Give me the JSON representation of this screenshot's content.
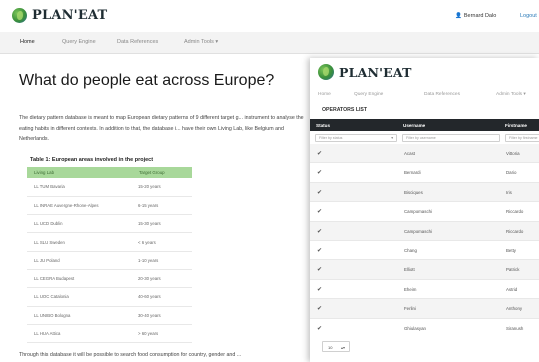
{
  "app": {
    "brand": "PLAN'EAT"
  },
  "topbar": {
    "user": "Bernard Dalo",
    "logout": "Logout"
  },
  "nav": {
    "items": [
      "Home",
      "Query Engine",
      "Data References",
      "Admin Tools ▾"
    ]
  },
  "page": {
    "title": "What do people eat across Europe?",
    "intro": "The dietary pattern database is meant to map European dietary patterns of 9 different target g... instrument to analyse the eating habits in different contexts. In addition to that, the database i... have their own Living Lab, like Belgium and Netherlands.",
    "outro": "Through this database it will be possible to search food consumption for country, gender and ..."
  },
  "living_labs_table": {
    "caption": "Table 1: European areas involved in the project",
    "columns": [
      "Living Lab",
      "Target Group"
    ],
    "rows": [
      [
        "LL TUM Bavaria",
        "15-20 years"
      ],
      [
        "LL INRAE Auvergne-Rhone-Alpes",
        "6-15 years"
      ],
      [
        "LL UCD Dublin",
        "15-30 years"
      ],
      [
        "LL SLU Sweden",
        "< 6 years"
      ],
      [
        "LL JU Poland",
        "1-10 years"
      ],
      [
        "LL CEGRA Budapest",
        "20-30 years"
      ],
      [
        "LL UOC Catalonia",
        "40-60 years"
      ],
      [
        "LL UNIBO Bologna",
        "30-40 years"
      ],
      [
        "LL HUA Attica",
        "> 60 years"
      ]
    ]
  },
  "overlay": {
    "nav": [
      "Home",
      "Query Engine",
      "Data References",
      "Admin Tools ▾"
    ],
    "title": "OPERATORS LIST",
    "columns": [
      "Status",
      "Username",
      "Firstname"
    ],
    "filters": {
      "status_placeholder": "Filter by status",
      "username_placeholder": "Filter by username",
      "firstname_placeholder": "Filter by firstname"
    },
    "rows": [
      {
        "status": "✔",
        "username": "Acast",
        "firstname": "Vittoria"
      },
      {
        "status": "✔",
        "username": "Bernardi",
        "firstname": "Dario"
      },
      {
        "status": "✔",
        "username": "Bisciques",
        "firstname": "Iris"
      },
      {
        "status": "✔",
        "username": "Campomaschi",
        "firstname": "Riccardo"
      },
      {
        "status": "✔",
        "username": "Campomaschi",
        "firstname": "Riccardo"
      },
      {
        "status": "✔",
        "username": "Chang",
        "firstname": "Betty"
      },
      {
        "status": "✔",
        "username": "Elliott",
        "firstname": "Patrick"
      },
      {
        "status": "✔",
        "username": "Eheim",
        "firstname": "Astrid"
      },
      {
        "status": "✔",
        "username": "Ferlini",
        "firstname": "Anthony"
      },
      {
        "status": "✔",
        "username": "Ghiulasyan",
        "firstname": "Siranush"
      }
    ],
    "page_size": "10"
  }
}
